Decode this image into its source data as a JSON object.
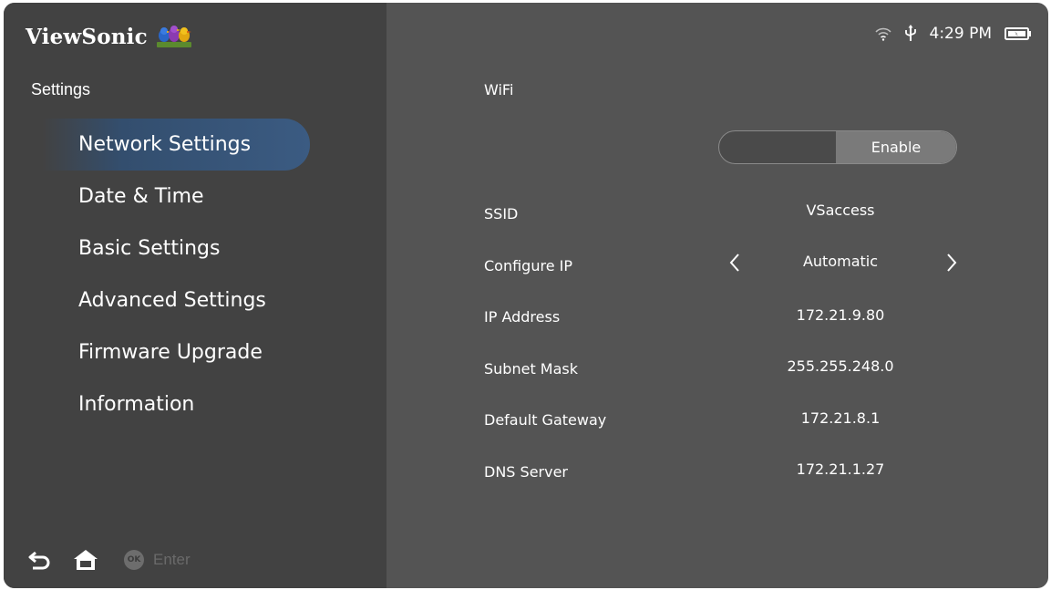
{
  "brand": {
    "name": "ViewSonic",
    "logo_icon": "viewsonic-birds-logo"
  },
  "sidebar": {
    "title": "Settings",
    "items": [
      {
        "label": "Network Settings",
        "active": true
      },
      {
        "label": "Date & Time"
      },
      {
        "label": "Basic Settings"
      },
      {
        "label": "Advanced Settings"
      },
      {
        "label": "Firmware Upgrade"
      },
      {
        "label": "Information"
      }
    ],
    "bottom": {
      "back_icon": "back-icon",
      "home_icon": "home-icon",
      "ok_badge": "OK",
      "enter_label": "Enter"
    }
  },
  "status_bar": {
    "icons": [
      "wifi-icon",
      "usb-icon",
      "battery-icon"
    ],
    "time": "4:29 PM"
  },
  "network": {
    "wifi_label": "WiFi",
    "wifi_toggle_state": "Enable",
    "ssid_label": "SSID",
    "ssid_value": "VSaccess",
    "configure_ip_label": "Configure IP",
    "configure_ip_value": "Automatic",
    "ip_label": "IP Address",
    "ip_value": "172.21.9.80",
    "subnet_label": "Subnet Mask",
    "subnet_value": "255.255.248.0",
    "gateway_label": "Default Gateway",
    "gateway_value": "172.21.8.1",
    "dns_label": "DNS Server",
    "dns_value": "172.21.1.27"
  },
  "colors": {
    "sidebar_bg": "#424242",
    "main_bg": "#545454",
    "active_item": "#3b5b82"
  }
}
